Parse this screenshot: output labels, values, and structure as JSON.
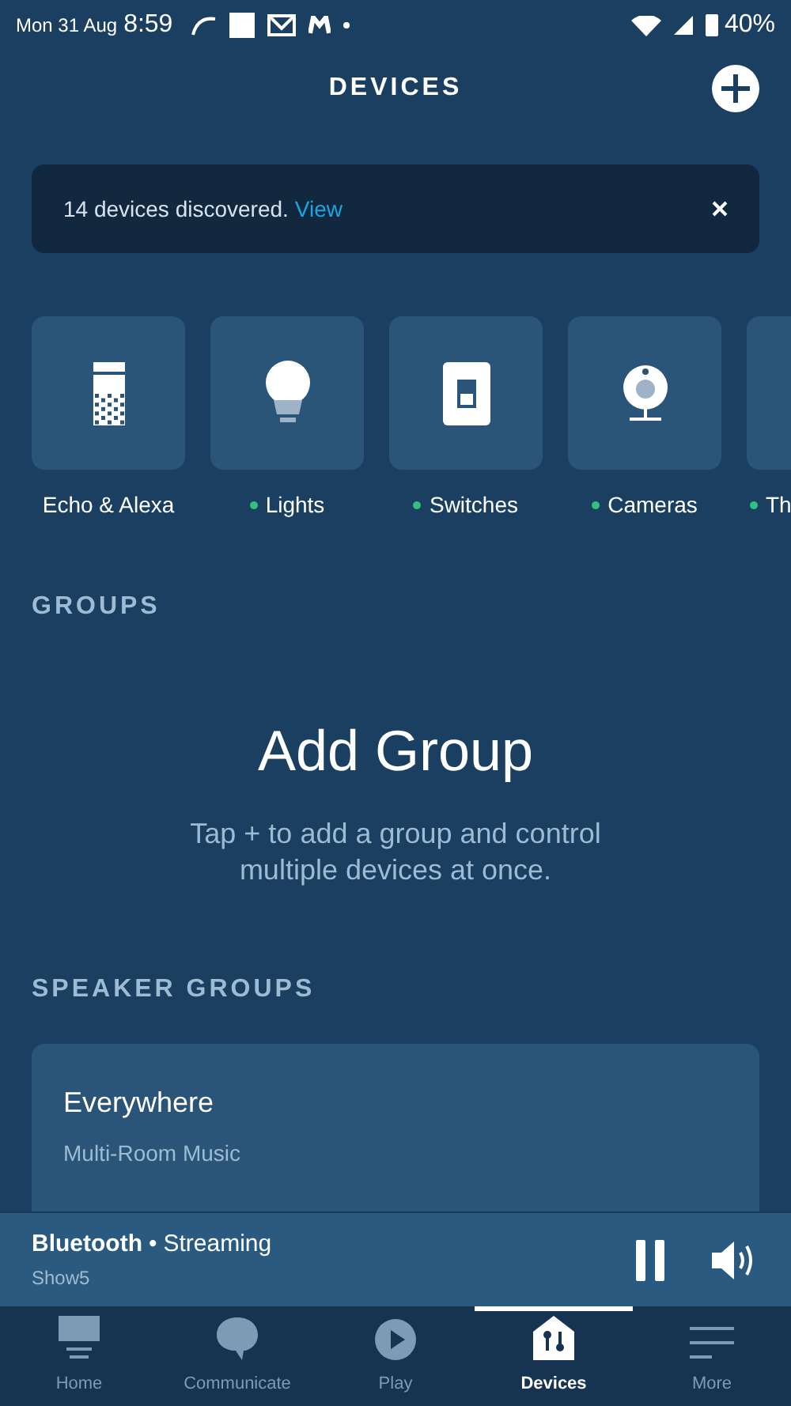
{
  "status_bar": {
    "date": "Mon 31 Aug",
    "time": "8:59",
    "battery": "40%"
  },
  "header": {
    "title": "DEVICES"
  },
  "banner": {
    "message": "14 devices discovered.",
    "link": "View"
  },
  "categories": [
    {
      "kind": "echo",
      "label": "Echo & Alexa",
      "status_dot": false
    },
    {
      "kind": "light",
      "label": "Lights",
      "status_dot": true
    },
    {
      "kind": "switch",
      "label": "Switches",
      "status_dot": true
    },
    {
      "kind": "camera",
      "label": "Cameras",
      "status_dot": true
    },
    {
      "kind": "other",
      "label": "Th",
      "status_dot": true
    }
  ],
  "groups": {
    "heading": "GROUPS",
    "empty_title": "Add Group",
    "empty_text": "Tap + to add a group and control multiple devices at once."
  },
  "speaker_groups": {
    "heading": "SPEAKER GROUPS",
    "cards": [
      {
        "title": "Everywhere",
        "subtitle": "Multi-Room Music"
      }
    ]
  },
  "player": {
    "source": "Bluetooth",
    "separator": "•",
    "state": "Streaming",
    "device": "Show5",
    "playing": true
  },
  "nav": [
    {
      "kind": "home",
      "label": "Home",
      "selected": false
    },
    {
      "kind": "communicate",
      "label": "Communicate",
      "selected": false
    },
    {
      "kind": "play",
      "label": "Play",
      "selected": false
    },
    {
      "kind": "devices",
      "label": "Devices",
      "selected": true
    },
    {
      "kind": "more",
      "label": "More",
      "selected": false
    }
  ]
}
